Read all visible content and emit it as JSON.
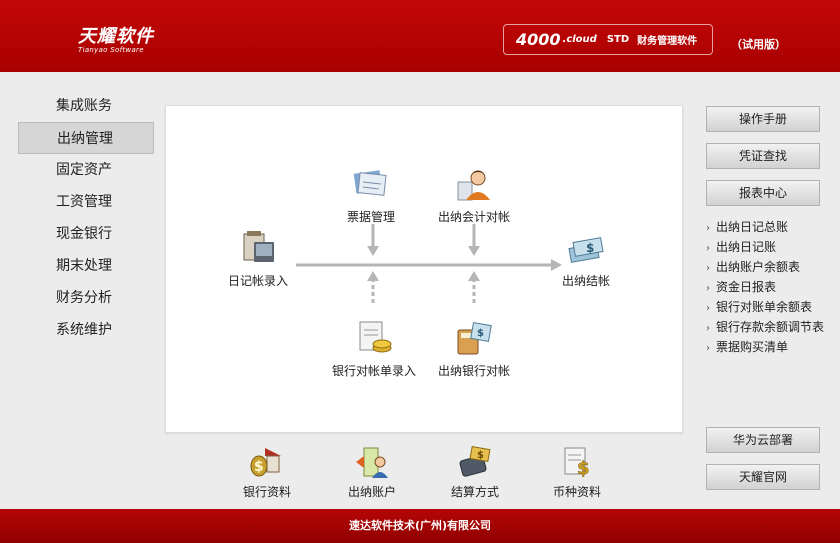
{
  "header": {
    "logo_cn": "天耀软件",
    "logo_en": "Tianyao Software",
    "product_number": "4000",
    "product_cloud": ".cloud",
    "product_std": "STD",
    "product_name": "财务管理软件",
    "trial": "（试用版）"
  },
  "left_nav": {
    "items": [
      {
        "label": "集成账务",
        "active": false
      },
      {
        "label": "出纳管理",
        "active": true
      },
      {
        "label": "固定资产",
        "active": false
      },
      {
        "label": "工资管理",
        "active": false
      },
      {
        "label": "现金银行",
        "active": false
      },
      {
        "label": "期末处理",
        "active": false
      },
      {
        "label": "财务分析",
        "active": false
      },
      {
        "label": "系统维护",
        "active": false
      }
    ]
  },
  "flow": {
    "journal_entry": "日记帐录入",
    "bill_management": "票据管理",
    "cashier_accounting_reconcile": "出纳会计对帐",
    "cashier_closing": "出纳结帐",
    "bank_statement_entry": "银行对帐单录入",
    "cashier_bank_reconcile": "出纳银行对帐"
  },
  "right_panel": {
    "manual_button": "操作手册",
    "voucher_search_button": "凭证查找",
    "report_center_button": "报表中心",
    "reports": [
      "出纳日记总账",
      "出纳日记账",
      "出纳账户余额表",
      "资金日报表",
      "银行对账单余额表",
      "银行存款余额调节表",
      "票据购买清单"
    ],
    "huawei_button": "华为云部署",
    "official_site_button": "天耀官网"
  },
  "bottom_tools": {
    "bank_info": "银行资料",
    "cashier_account": "出纳账户",
    "settlement_method": "结算方式",
    "currency_info": "币种资料"
  },
  "footer": {
    "company": "速达软件技术(广州)有限公司"
  },
  "colors": {
    "brand_red": "#b00000",
    "panel_bg": "#ffffff",
    "page_bg": "#ececec"
  }
}
